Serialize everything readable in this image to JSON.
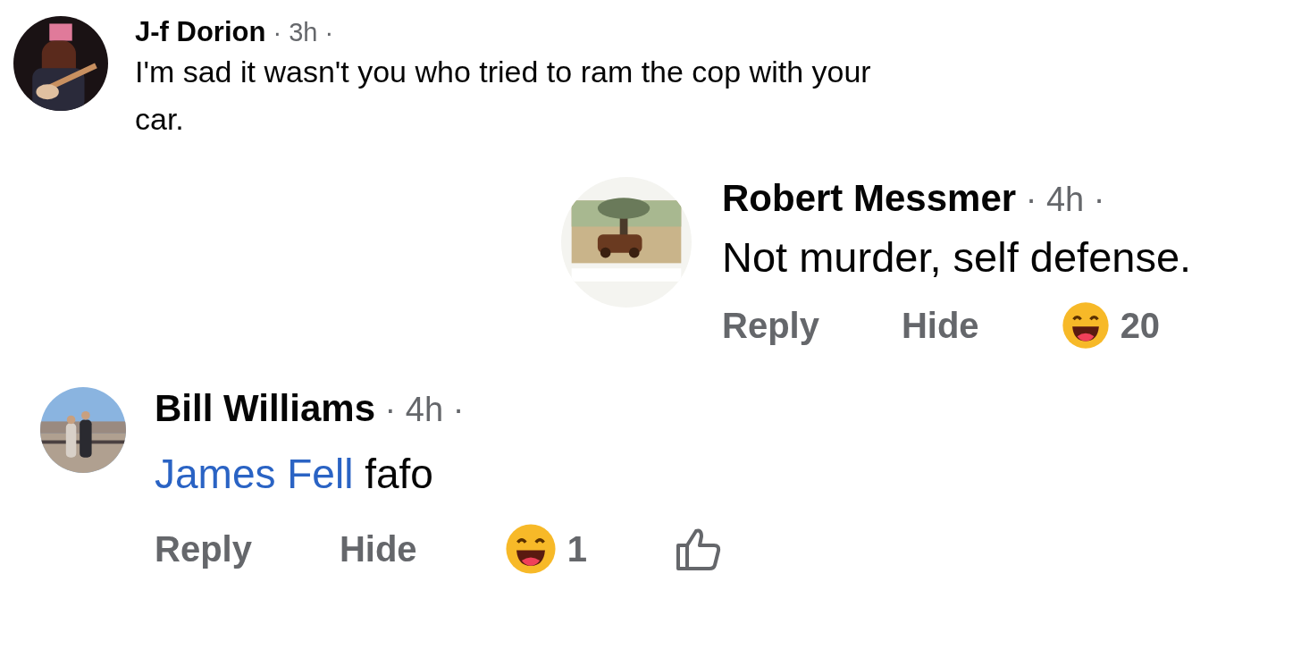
{
  "comments": [
    {
      "author": "J-f Dorion",
      "time": "· 3h ·",
      "avatar": {
        "kind": "picture"
      },
      "text": "I'm sad it wasn't you who tried to ram the cop with your car."
    },
    {
      "author": "Robert Messmer",
      "time": "· 4h ·",
      "avatar": {
        "kind": "picture"
      },
      "text": "Not murder, self defense.",
      "actions": [
        {
          "kind": "reply",
          "label": "Reply"
        },
        {
          "kind": "hide",
          "label": "Hide"
        },
        {
          "kind": "reaction",
          "count": "20"
        }
      ]
    },
    {
      "author": "Bill Williams",
      "time": "· 4h ·",
      "avatar": {
        "kind": "picture"
      },
      "mention": "James Fell",
      "text": "fafo",
      "actions": [
        {
          "kind": "reply",
          "label": "Reply"
        },
        {
          "kind": "hide",
          "label": "Hide"
        },
        {
          "kind": "reaction",
          "count": "1"
        },
        {
          "kind": "like"
        }
      ]
    }
  ]
}
